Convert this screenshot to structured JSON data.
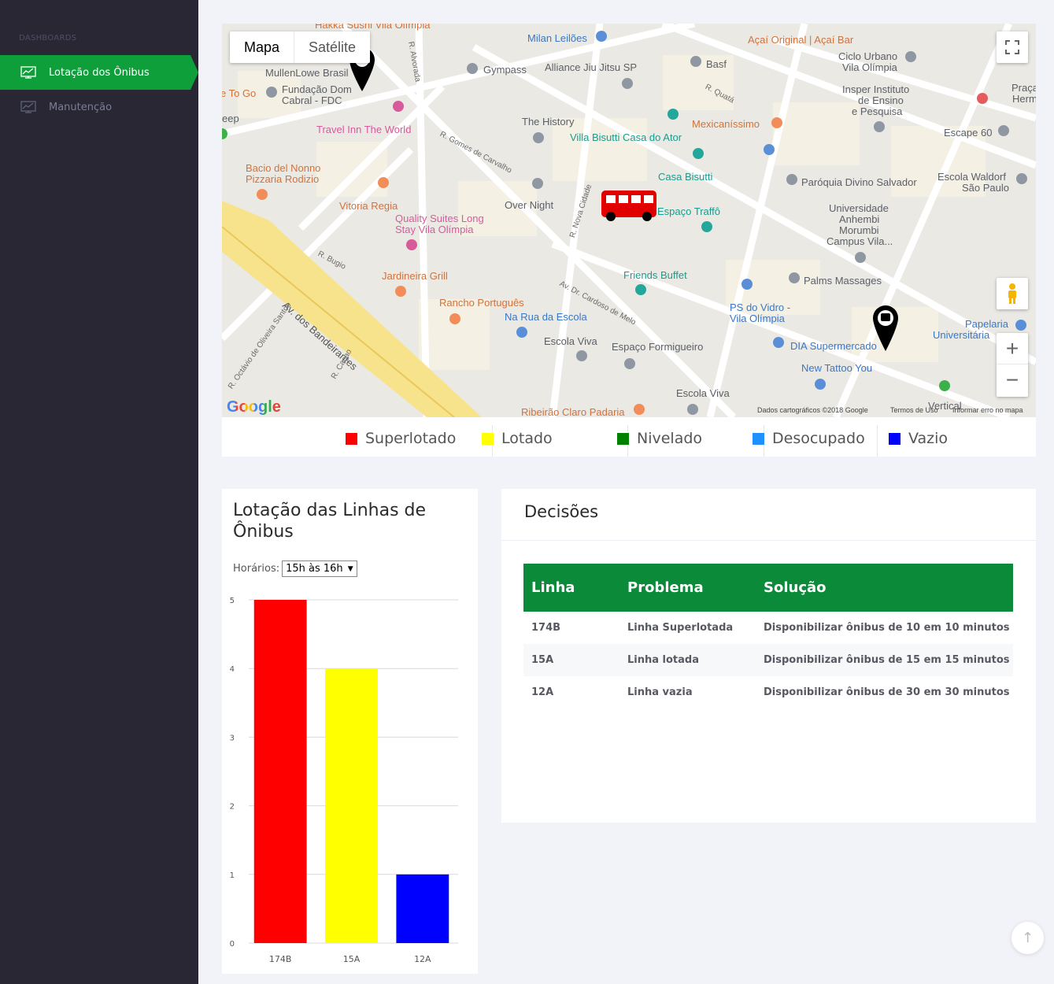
{
  "sidebar": {
    "heading": "DASHBOARDS",
    "items": [
      {
        "label": "Lotação dos Ônibus",
        "icon": "chart-line-icon",
        "active": true
      },
      {
        "label": "Manutenção",
        "icon": "chart-line-icon",
        "active": false
      }
    ]
  },
  "map": {
    "type_buttons": [
      "Mapa",
      "Satélite"
    ],
    "zoom_in": "+",
    "zoom_out": "−",
    "logo": "Google",
    "attribution": [
      "Dados cartográficos ©2018 Google",
      "Termos de Uso",
      "Informar erro no mapa"
    ],
    "labels": [
      "Hakka Sushi Vila Olímpia",
      "Milan Leilões",
      "Açaí Original | Açaí Bar",
      "Ciclo Urbano",
      "Vila Olímpia",
      "Basf",
      "Gympass",
      "Alliance Jiu Jitsu SP",
      "MullenLowe Brasil",
      "Fundação Dom",
      "Cabral - FDC",
      "e To Go",
      "Insper Instituto",
      "de Ensino",
      "e Pesquisa",
      "Praça",
      "Herm",
      "Travel Inn The World",
      "The History",
      "Mexicaníssimo",
      "Villa Bisutti Casa do Ator",
      "Escape 60",
      "Bacio del Nonno",
      "Pizzaria Rodizio",
      "Casa Bisutti",
      "Paróquia Divino Salvador",
      "Escola Waldorf",
      "São Paulo",
      "Over Night",
      "Espaço Traffô",
      "Vitoria Regia",
      "Quality Suites Long",
      "Stay Vila Olímpia",
      "Universidade",
      "Anhembi",
      "Morumbi",
      "Campus Vila...",
      "Jardineira Grill",
      "Friends Buffet",
      "Palms Massages",
      "Rancho Português",
      "PS do Vidro -",
      "Vila Olímpia",
      "Papelaria",
      "Universitária",
      "Na Rua da Escola",
      "Escola Viva",
      "Espaço Formigueiro",
      "DIA Supermercado",
      "New Tattoo You",
      "Escola Viva",
      "Ribeirão Claro Padaria",
      "Vertical",
      "Av. dos Bandeirantes",
      "R. Gomes de Carvalho",
      "R. Alvorada",
      "R. Quatá",
      "R. Bugio",
      "R. Nova Cidade",
      "Av. Dr. Cardoso de Melo",
      "R. Caçao",
      "R. Octávio de Oliveira Santos",
      "eep"
    ]
  },
  "legend": [
    {
      "label": "Superlotado",
      "color": "#ff0000"
    },
    {
      "label": "Lotado",
      "color": "#ffff00"
    },
    {
      "label": "Nivelado",
      "color": "#008000"
    },
    {
      "label": "Desocupado",
      "color": "#1e90ff"
    },
    {
      "label": "Vazio",
      "color": "#0000ff"
    }
  ],
  "chart_card": {
    "title": "Lotação das Linhas de Ônibus",
    "filter_label": "Horários:",
    "filter_value": "15h às 16h"
  },
  "chart_data": {
    "type": "bar",
    "categories": [
      "174B",
      "15A",
      "12A"
    ],
    "values": [
      5,
      4,
      1
    ],
    "colors": [
      "#ff0000",
      "#ffff00",
      "#0000ff"
    ],
    "ylim": [
      0,
      5
    ],
    "yticks": [
      0,
      1,
      2,
      3,
      4,
      5
    ],
    "grid": true
  },
  "decisions": {
    "title": "Decisões",
    "columns": [
      "Linha",
      "Problema",
      "Solução"
    ],
    "rows": [
      [
        "174B",
        "Linha Superlotada",
        "Disponibilizar ônibus de 10 em 10 minutos"
      ],
      [
        "15A",
        "Linha lotada",
        "Disponibilizar ônibus de 15 em 15 minutos"
      ],
      [
        "12A",
        "Linha vazia",
        "Disponibilizar ônibus de 30 em 30 minutos"
      ]
    ]
  },
  "scroll_top": "↑"
}
